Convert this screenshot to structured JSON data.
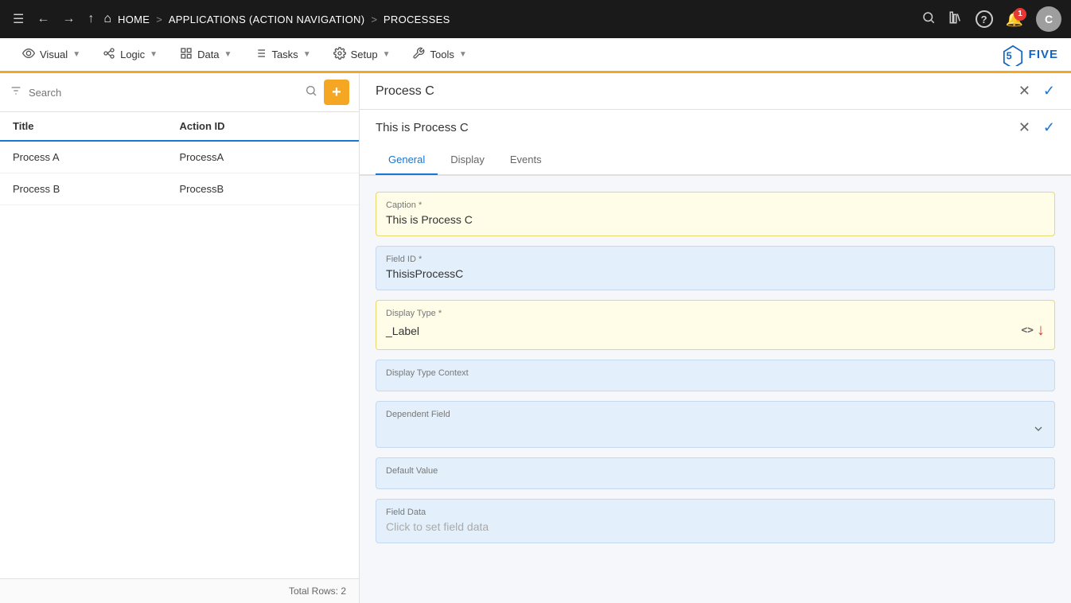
{
  "topNav": {
    "menuIcon": "☰",
    "backIcon": "←",
    "forwardIcon": "→",
    "upIcon": "↑",
    "homeIcon": "⌂",
    "homeLabel": "HOME",
    "sep1": ">",
    "appLabel": "APPLICATIONS (ACTION NAVIGATION)",
    "sep2": ">",
    "processLabel": "PROCESSES",
    "searchIcon": "🔍",
    "booksIcon": "📚",
    "helpIcon": "?",
    "notificationIcon": "🔔",
    "notificationCount": "1",
    "avatarLabel": "C"
  },
  "menuBar": {
    "items": [
      {
        "id": "visual",
        "icon": "👁",
        "label": "Visual"
      },
      {
        "id": "logic",
        "icon": "⚙",
        "label": "Logic"
      },
      {
        "id": "data",
        "icon": "⊞",
        "label": "Data"
      },
      {
        "id": "tasks",
        "icon": "☰",
        "label": "Tasks"
      },
      {
        "id": "setup",
        "icon": "⚙",
        "label": "Setup"
      },
      {
        "id": "tools",
        "icon": "🔧",
        "label": "Tools"
      }
    ],
    "logoText": "FIVE"
  },
  "sidebar": {
    "searchPlaceholder": "Search",
    "addButtonLabel": "+",
    "table": {
      "columns": [
        {
          "id": "title",
          "label": "Title"
        },
        {
          "id": "actionId",
          "label": "Action ID"
        }
      ],
      "rows": [
        {
          "title": "Process A",
          "actionId": "ProcessA"
        },
        {
          "title": "Process B",
          "actionId": "ProcessB"
        }
      ],
      "footer": "Total Rows: 2"
    }
  },
  "rightPanel": {
    "title": "Process C",
    "closeIcon": "✕",
    "checkIcon": "✓",
    "subPanel": {
      "title": "This is Process C",
      "closeIcon": "✕",
      "checkIcon": "✓"
    },
    "tabs": [
      {
        "id": "general",
        "label": "General",
        "active": true
      },
      {
        "id": "display",
        "label": "Display",
        "active": false
      },
      {
        "id": "events",
        "label": "Events",
        "active": false
      }
    ],
    "form": {
      "caption": {
        "label": "Caption *",
        "value": "This is Process C"
      },
      "fieldId": {
        "label": "Field ID *",
        "value": "ThisisProcessC"
      },
      "displayType": {
        "label": "Display Type *",
        "value": "_Label",
        "codeIcon": "<>",
        "arrowIcon": "↓"
      },
      "displayTypeContext": {
        "label": "Display Type Context",
        "value": ""
      },
      "dependentField": {
        "label": "Dependent Field",
        "value": ""
      },
      "defaultValue": {
        "label": "Default Value",
        "value": ""
      },
      "fieldData": {
        "label": "Field Data",
        "value": "Click to set field data"
      }
    }
  }
}
